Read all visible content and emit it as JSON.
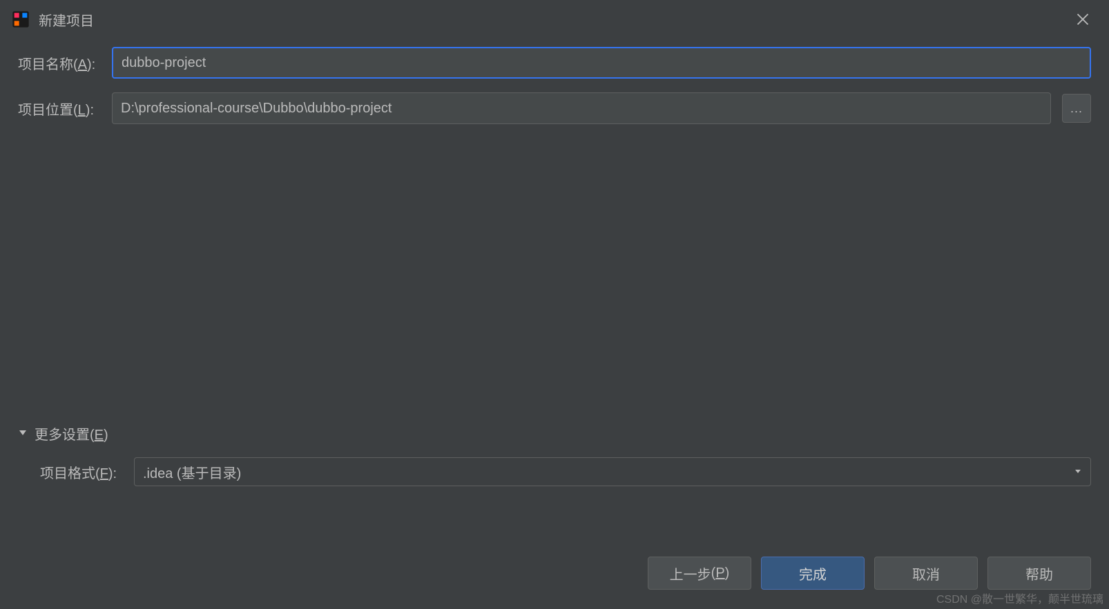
{
  "titlebar": {
    "title": "新建项目"
  },
  "form": {
    "project_name_label_prefix": "项目名称",
    "project_name_label_key": "A",
    "project_name_value": "dubbo-project",
    "project_location_label_prefix": "项目位置",
    "project_location_label_key": "L",
    "project_location_value": "D:\\professional-course\\Dubbo\\dubbo-project",
    "browse_label": "..."
  },
  "more_settings": {
    "title_prefix": "更多设置",
    "title_key": "E",
    "project_format_label_prefix": "项目格式",
    "project_format_label_key": "F",
    "project_format_value": ".idea (基于目录)"
  },
  "footer": {
    "previous_prefix": "上一步 ",
    "previous_key": "P",
    "finish": "完成",
    "cancel": "取消",
    "help": "帮助"
  },
  "watermark": "CSDN @散一世繁华，颠半世琉璃"
}
